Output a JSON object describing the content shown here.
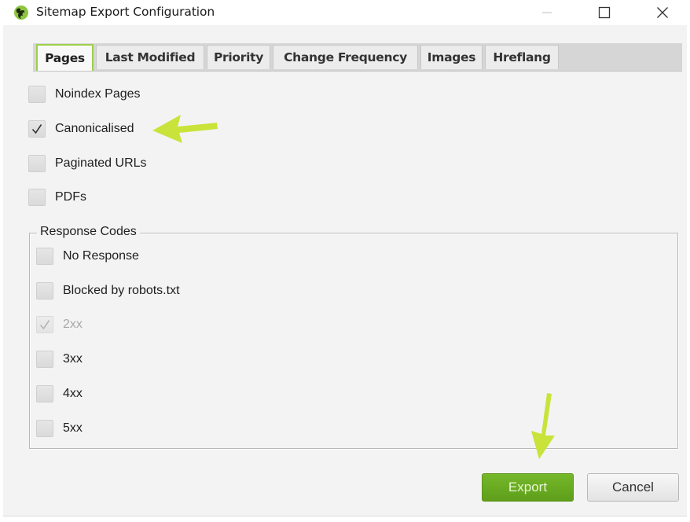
{
  "window": {
    "title": "Sitemap Export Configuration",
    "controls": [
      "minimize",
      "maximize",
      "close"
    ]
  },
  "tabs": [
    {
      "label": "Pages",
      "active": true
    },
    {
      "label": "Last Modified",
      "active": false
    },
    {
      "label": "Priority",
      "active": false
    },
    {
      "label": "Change Frequency",
      "active": false
    },
    {
      "label": "Images",
      "active": false
    },
    {
      "label": "Hreflang",
      "active": false
    }
  ],
  "pages_options": [
    {
      "label": "Noindex Pages",
      "checked": false,
      "disabled": false
    },
    {
      "label": "Canonicalised",
      "checked": true,
      "disabled": false
    },
    {
      "label": "Paginated URLs",
      "checked": false,
      "disabled": false
    },
    {
      "label": "PDFs",
      "checked": false,
      "disabled": false
    }
  ],
  "response_codes": {
    "title": "Response Codes",
    "options": [
      {
        "label": "No Response",
        "checked": false,
        "disabled": false
      },
      {
        "label": "Blocked by robots.txt",
        "checked": false,
        "disabled": false
      },
      {
        "label": "2xx",
        "checked": true,
        "disabled": true
      },
      {
        "label": "3xx",
        "checked": false,
        "disabled": false
      },
      {
        "label": "4xx",
        "checked": false,
        "disabled": false
      },
      {
        "label": "5xx",
        "checked": false,
        "disabled": false
      }
    ]
  },
  "buttons": {
    "export_label": "Export",
    "cancel_label": "Cancel"
  },
  "annotations": {
    "arrow_color": "#c9e33a",
    "targets": [
      "Canonicalised",
      "Export"
    ]
  },
  "colors": {
    "accent_green": "#6aab22",
    "active_tab_border": "#9bd04a"
  }
}
